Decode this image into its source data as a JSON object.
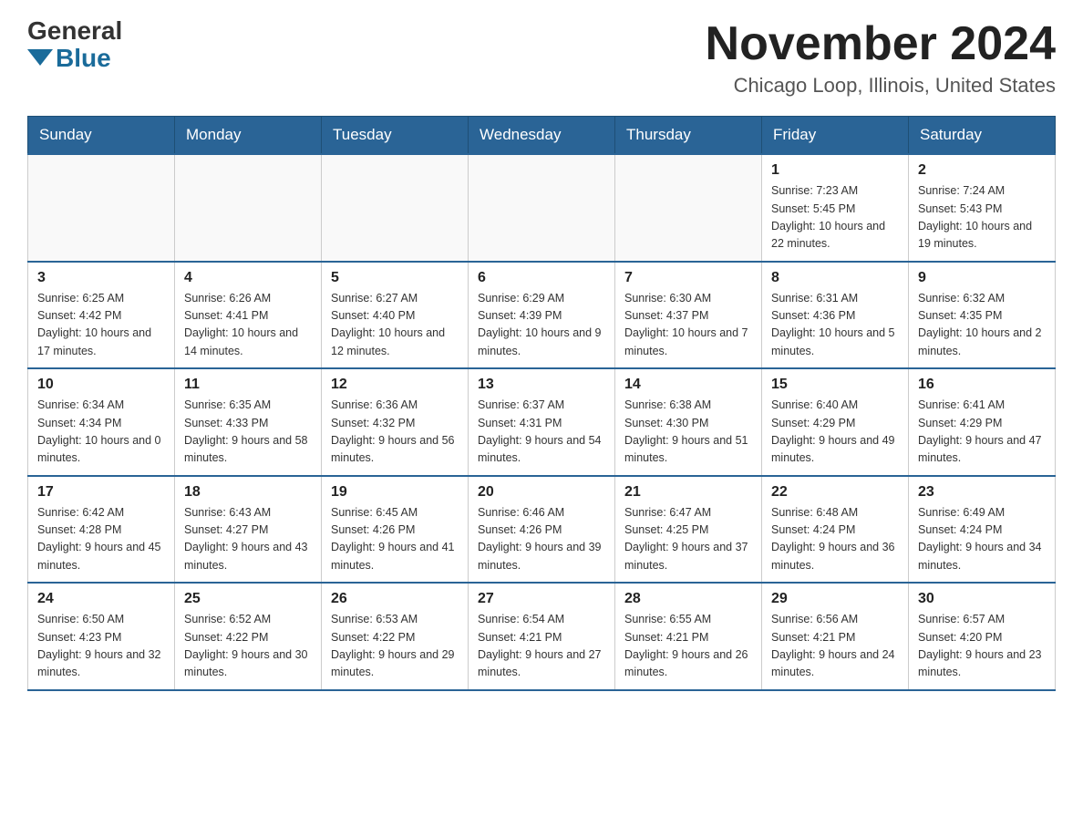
{
  "header": {
    "logo_general": "General",
    "logo_blue": "Blue",
    "main_title": "November 2024",
    "subtitle": "Chicago Loop, Illinois, United States"
  },
  "calendar": {
    "days_of_week": [
      "Sunday",
      "Monday",
      "Tuesday",
      "Wednesday",
      "Thursday",
      "Friday",
      "Saturday"
    ],
    "weeks": [
      [
        {
          "day": "",
          "info": ""
        },
        {
          "day": "",
          "info": ""
        },
        {
          "day": "",
          "info": ""
        },
        {
          "day": "",
          "info": ""
        },
        {
          "day": "",
          "info": ""
        },
        {
          "day": "1",
          "info": "Sunrise: 7:23 AM\nSunset: 5:45 PM\nDaylight: 10 hours and 22 minutes."
        },
        {
          "day": "2",
          "info": "Sunrise: 7:24 AM\nSunset: 5:43 PM\nDaylight: 10 hours and 19 minutes."
        }
      ],
      [
        {
          "day": "3",
          "info": "Sunrise: 6:25 AM\nSunset: 4:42 PM\nDaylight: 10 hours and 17 minutes."
        },
        {
          "day": "4",
          "info": "Sunrise: 6:26 AM\nSunset: 4:41 PM\nDaylight: 10 hours and 14 minutes."
        },
        {
          "day": "5",
          "info": "Sunrise: 6:27 AM\nSunset: 4:40 PM\nDaylight: 10 hours and 12 minutes."
        },
        {
          "day": "6",
          "info": "Sunrise: 6:29 AM\nSunset: 4:39 PM\nDaylight: 10 hours and 9 minutes."
        },
        {
          "day": "7",
          "info": "Sunrise: 6:30 AM\nSunset: 4:37 PM\nDaylight: 10 hours and 7 minutes."
        },
        {
          "day": "8",
          "info": "Sunrise: 6:31 AM\nSunset: 4:36 PM\nDaylight: 10 hours and 5 minutes."
        },
        {
          "day": "9",
          "info": "Sunrise: 6:32 AM\nSunset: 4:35 PM\nDaylight: 10 hours and 2 minutes."
        }
      ],
      [
        {
          "day": "10",
          "info": "Sunrise: 6:34 AM\nSunset: 4:34 PM\nDaylight: 10 hours and 0 minutes."
        },
        {
          "day": "11",
          "info": "Sunrise: 6:35 AM\nSunset: 4:33 PM\nDaylight: 9 hours and 58 minutes."
        },
        {
          "day": "12",
          "info": "Sunrise: 6:36 AM\nSunset: 4:32 PM\nDaylight: 9 hours and 56 minutes."
        },
        {
          "day": "13",
          "info": "Sunrise: 6:37 AM\nSunset: 4:31 PM\nDaylight: 9 hours and 54 minutes."
        },
        {
          "day": "14",
          "info": "Sunrise: 6:38 AM\nSunset: 4:30 PM\nDaylight: 9 hours and 51 minutes."
        },
        {
          "day": "15",
          "info": "Sunrise: 6:40 AM\nSunset: 4:29 PM\nDaylight: 9 hours and 49 minutes."
        },
        {
          "day": "16",
          "info": "Sunrise: 6:41 AM\nSunset: 4:29 PM\nDaylight: 9 hours and 47 minutes."
        }
      ],
      [
        {
          "day": "17",
          "info": "Sunrise: 6:42 AM\nSunset: 4:28 PM\nDaylight: 9 hours and 45 minutes."
        },
        {
          "day": "18",
          "info": "Sunrise: 6:43 AM\nSunset: 4:27 PM\nDaylight: 9 hours and 43 minutes."
        },
        {
          "day": "19",
          "info": "Sunrise: 6:45 AM\nSunset: 4:26 PM\nDaylight: 9 hours and 41 minutes."
        },
        {
          "day": "20",
          "info": "Sunrise: 6:46 AM\nSunset: 4:26 PM\nDaylight: 9 hours and 39 minutes."
        },
        {
          "day": "21",
          "info": "Sunrise: 6:47 AM\nSunset: 4:25 PM\nDaylight: 9 hours and 37 minutes."
        },
        {
          "day": "22",
          "info": "Sunrise: 6:48 AM\nSunset: 4:24 PM\nDaylight: 9 hours and 36 minutes."
        },
        {
          "day": "23",
          "info": "Sunrise: 6:49 AM\nSunset: 4:24 PM\nDaylight: 9 hours and 34 minutes."
        }
      ],
      [
        {
          "day": "24",
          "info": "Sunrise: 6:50 AM\nSunset: 4:23 PM\nDaylight: 9 hours and 32 minutes."
        },
        {
          "day": "25",
          "info": "Sunrise: 6:52 AM\nSunset: 4:22 PM\nDaylight: 9 hours and 30 minutes."
        },
        {
          "day": "26",
          "info": "Sunrise: 6:53 AM\nSunset: 4:22 PM\nDaylight: 9 hours and 29 minutes."
        },
        {
          "day": "27",
          "info": "Sunrise: 6:54 AM\nSunset: 4:21 PM\nDaylight: 9 hours and 27 minutes."
        },
        {
          "day": "28",
          "info": "Sunrise: 6:55 AM\nSunset: 4:21 PM\nDaylight: 9 hours and 26 minutes."
        },
        {
          "day": "29",
          "info": "Sunrise: 6:56 AM\nSunset: 4:21 PM\nDaylight: 9 hours and 24 minutes."
        },
        {
          "day": "30",
          "info": "Sunrise: 6:57 AM\nSunset: 4:20 PM\nDaylight: 9 hours and 23 minutes."
        }
      ]
    ]
  }
}
